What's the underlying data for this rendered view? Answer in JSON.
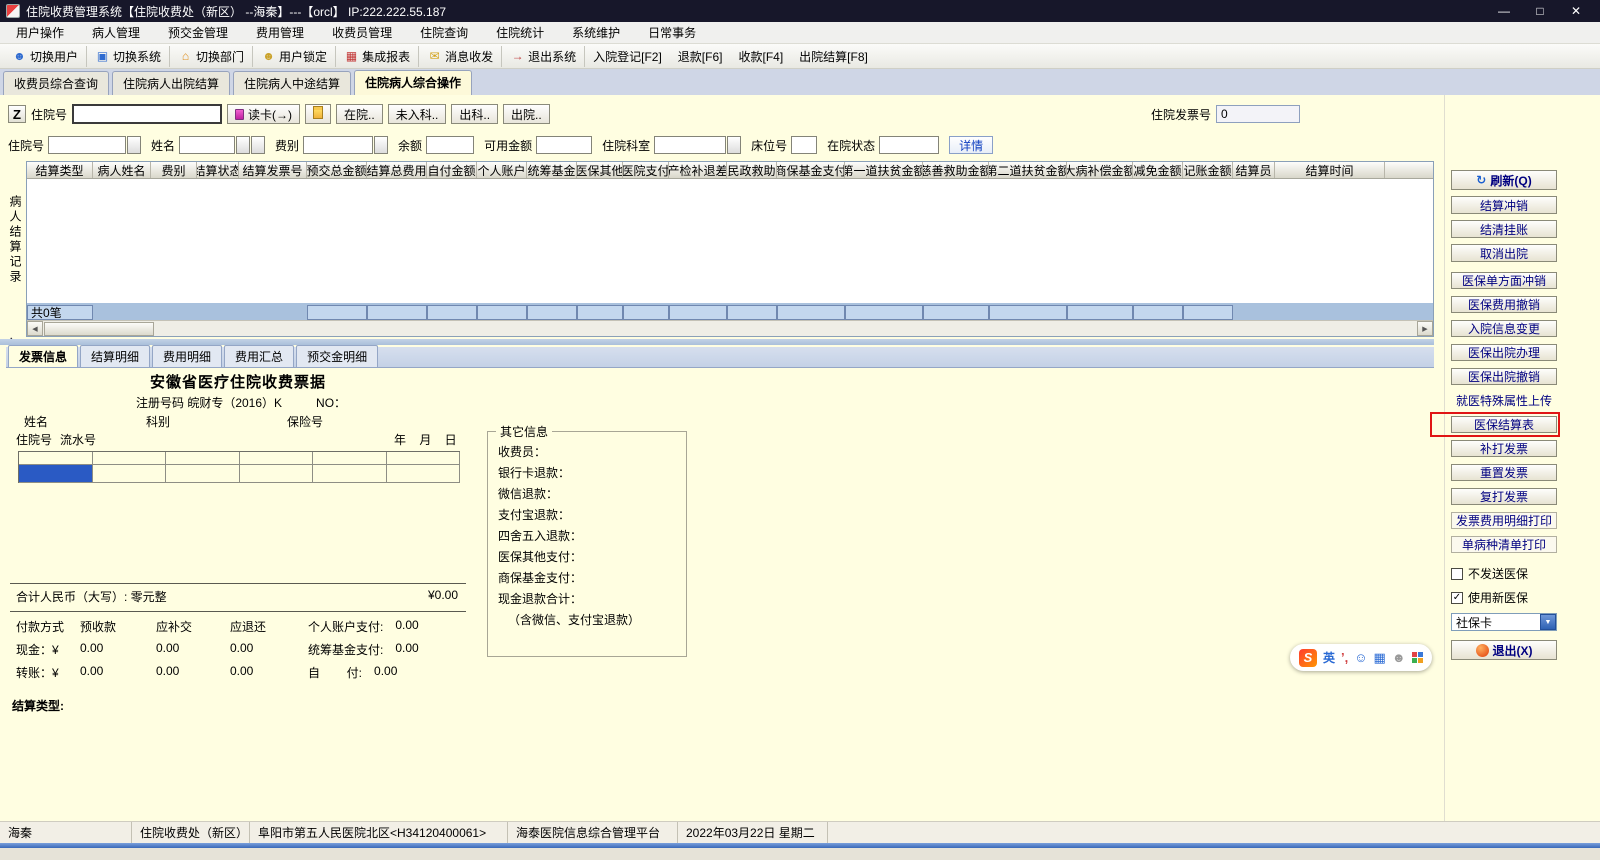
{
  "titlebar": {
    "title": "住院收费管理系统【住院收费处（新区） --海秦】---【orcl】  IP:222.222.55.187",
    "controls": {
      "minimize": "—",
      "maximize": "□",
      "close": "✕"
    }
  },
  "menubar": {
    "items": [
      "用户操作",
      "病人管理",
      "预交金管理",
      "费用管理",
      "收费员管理",
      "住院查询",
      "住院统计",
      "系统维护",
      "日常事务"
    ]
  },
  "toolbar": {
    "buttons": [
      {
        "label": "切换用户",
        "icon": "switch-user"
      },
      {
        "label": "切换系统",
        "icon": "switch-system"
      },
      {
        "label": "切换部门",
        "icon": "switch-department"
      },
      {
        "label": "用户锁定",
        "icon": "user-lock"
      },
      {
        "label": "集成报表",
        "icon": "integrated-report"
      },
      {
        "label": "消息收发",
        "icon": "message"
      },
      {
        "label": "退出系统",
        "icon": "exit-system"
      },
      {
        "label": "入院登记[F2]",
        "icon": "none"
      },
      {
        "label": "退款[F6]",
        "icon": "none"
      },
      {
        "label": "收款[F4]",
        "icon": "none"
      },
      {
        "label": "出院结算[F8]",
        "icon": "none"
      }
    ]
  },
  "pagetabs": {
    "items": [
      "收费员综合查询",
      "住院病人出院结算",
      "住院病人中途结算",
      "住院病人综合操作"
    ],
    "active_index": 3
  },
  "search_row": {
    "z_button": "Z",
    "hospital_no_label": "住院号",
    "input_value": "",
    "read_card_label": "读卡(→)",
    "quick_buttons": [
      "在院..",
      "未入科..",
      "出科..",
      "出院.."
    ],
    "invoice_no_label": "住院发票号",
    "invoice_no_value": "0"
  },
  "filter_row": {
    "fields": [
      {
        "label": "住院号"
      },
      {
        "label": "姓名"
      },
      {
        "label": "费别"
      },
      {
        "label": "余额"
      },
      {
        "label": "可用金额"
      },
      {
        "label": "住院科室"
      },
      {
        "label": "床位号"
      },
      {
        "label": "在院状态"
      }
    ],
    "detail_button": "详情"
  },
  "records_table": {
    "side_label": "病人结算记录",
    "columns": [
      "结算类型",
      "病人姓名",
      "费别",
      "结算状态",
      "结算发票号",
      "预交总金额",
      "结算总费用",
      "自付金额",
      "个人账户",
      "统筹基金",
      "医保其他",
      "医院支付",
      "产检补退差",
      "民政救助",
      "商保基金支付",
      "第一道扶贫金额",
      "慈善救助金额",
      "第二道扶贫金额",
      "大病补偿金额",
      "减免金额",
      "记账金额",
      "结算员",
      "结算时间"
    ],
    "summary": "共0笔"
  },
  "detail_tabs": {
    "items": [
      "发票信息",
      "结算明细",
      "费用明细",
      "费用汇总",
      "预交金明细"
    ],
    "active_index": 0
  },
  "invoice": {
    "title": "安徽省医疗住院收费票据",
    "reg_no": "注册号码 皖财专（2016）K",
    "no_label": "NO：",
    "fields": {
      "name": "姓名",
      "dept": "科别",
      "insurance": "保险号",
      "admission": "住院号",
      "serial": "流水号",
      "date": "年    月    日"
    },
    "total_label": "合计人民币（大写）: 零元整",
    "total_value": "¥0.00",
    "payment": {
      "headers": [
        "付款方式",
        "预收款",
        "应补交",
        "应退还"
      ],
      "rows": [
        {
          "label": "现金：¥",
          "values": [
            "0.00",
            "0.00",
            "0.00"
          ]
        },
        {
          "label": "转账：¥",
          "values": [
            "0.00",
            "0.00",
            "0.00"
          ]
        }
      ],
      "right": [
        {
          "label": "个人账户支付:",
          "value": "0.00"
        },
        {
          "label": "统筹基金支付:",
          "value": "0.00"
        },
        {
          "label": "自        付:",
          "value": "0.00"
        }
      ]
    },
    "settle_type_label": "结算类型:"
  },
  "other_info": {
    "title": "其它信息",
    "rows": [
      "收费员：",
      "银行卡退款：",
      "微信退款：",
      "支付宝退款：",
      "四舍五入退款：",
      "医保其他支付：",
      "商保基金支付：",
      "现金退款合计：",
      "（含微信、支付宝退款）"
    ]
  },
  "sidebar": {
    "refresh": "刷新(Q)",
    "buttons1": [
      "结算冲销",
      "结清挂账",
      "取消出院"
    ],
    "buttons2": [
      {
        "label": "医保单方面冲销",
        "style": "normal"
      },
      {
        "label": "医保费用撤销",
        "style": "normal"
      },
      {
        "label": "入院信息变更",
        "style": "normal"
      },
      {
        "label": "医保出院办理",
        "style": "normal"
      },
      {
        "label": "医保出院撤销",
        "style": "normal"
      },
      {
        "label": "就医特殊属性上传",
        "style": "flat"
      },
      {
        "label": "医保结算表",
        "style": "normal",
        "ring": true
      },
      {
        "label": "补打发票",
        "style": "normal"
      },
      {
        "label": "重置发票",
        "style": "normal"
      },
      {
        "label": "复打发票",
        "style": "normal"
      },
      {
        "label": "发票费用明细打印",
        "style": "thin"
      },
      {
        "label": "单病种清单打印",
        "style": "thin"
      }
    ],
    "checkboxes": [
      {
        "label": "不发送医保",
        "checked": false
      },
      {
        "label": "使用新医保",
        "checked": true
      }
    ],
    "card_select": "社保卡",
    "exit": "退出(X)"
  },
  "ime": {
    "brand": "S",
    "lang": "英"
  },
  "statusbar": {
    "items": [
      "海秦",
      "住院收费处（新区）",
      "阜阳市第五人民医院北区<H34120400061>",
      "海泰医院信息综合管理平台",
      "2022年03月22日 星期二"
    ]
  }
}
